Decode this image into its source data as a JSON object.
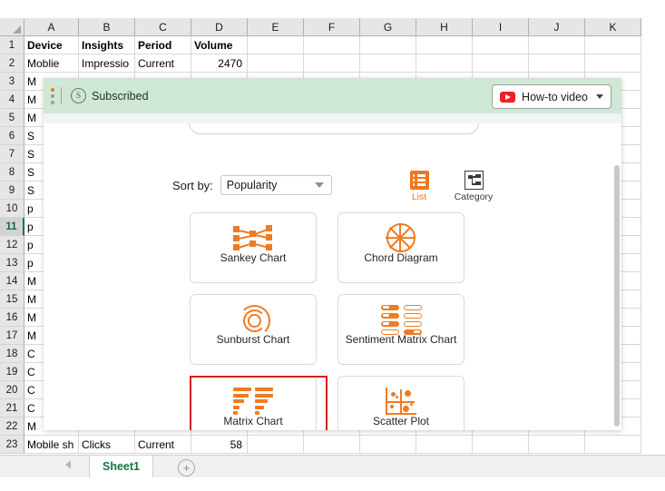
{
  "spreadsheet": {
    "columns": [
      "A",
      "B",
      "C",
      "D",
      "E",
      "F",
      "G",
      "H",
      "I",
      "J",
      "K"
    ],
    "rows": [
      {
        "n": "1",
        "cells": [
          "Device",
          "Insights",
          "Period",
          "Volume",
          "",
          "",
          "",
          "",
          "",
          "",
          ""
        ],
        "header": true
      },
      {
        "n": "2",
        "cells": [
          "Moblie",
          "Impressio",
          "Current",
          "2470",
          "",
          "",
          "",
          "",
          "",
          "",
          ""
        ]
      },
      {
        "n": "3",
        "cells": [
          "M",
          "",
          "",
          "",
          "",
          "",
          "",
          "",
          "",
          "",
          ""
        ]
      },
      {
        "n": "4",
        "cells": [
          "M",
          "",
          "",
          "",
          "",
          "",
          "",
          "",
          "",
          "",
          ""
        ]
      },
      {
        "n": "5",
        "cells": [
          "M",
          "",
          "",
          "",
          "",
          "",
          "",
          "",
          "",
          "",
          ""
        ]
      },
      {
        "n": "6",
        "cells": [
          "S",
          "",
          "",
          "",
          "",
          "",
          "",
          "",
          "",
          "",
          ""
        ]
      },
      {
        "n": "7",
        "cells": [
          "S",
          "",
          "",
          "",
          "",
          "",
          "",
          "",
          "",
          "",
          ""
        ]
      },
      {
        "n": "8",
        "cells": [
          "S",
          "",
          "",
          "",
          "",
          "",
          "",
          "",
          "",
          "",
          ""
        ]
      },
      {
        "n": "9",
        "cells": [
          "S",
          "",
          "",
          "",
          "",
          "",
          "",
          "",
          "",
          "",
          ""
        ]
      },
      {
        "n": "10",
        "cells": [
          "p",
          "",
          "",
          "",
          "",
          "",
          "",
          "",
          "",
          "",
          ""
        ]
      },
      {
        "n": "11",
        "cells": [
          "p",
          "",
          "",
          "",
          "",
          "",
          "",
          "",
          "",
          "",
          ""
        ],
        "selected": true
      },
      {
        "n": "12",
        "cells": [
          "p",
          "",
          "",
          "",
          "",
          "",
          "",
          "",
          "",
          "",
          ""
        ]
      },
      {
        "n": "13",
        "cells": [
          "p",
          "",
          "",
          "",
          "",
          "",
          "",
          "",
          "",
          "",
          ""
        ]
      },
      {
        "n": "14",
        "cells": [
          "M",
          "",
          "",
          "",
          "",
          "",
          "",
          "",
          "",
          "",
          ""
        ]
      },
      {
        "n": "15",
        "cells": [
          "M",
          "",
          "",
          "",
          "",
          "",
          "",
          "",
          "",
          "",
          ""
        ]
      },
      {
        "n": "16",
        "cells": [
          "M",
          "",
          "",
          "",
          "",
          "",
          "",
          "",
          "",
          "",
          ""
        ]
      },
      {
        "n": "17",
        "cells": [
          "M",
          "",
          "",
          "",
          "",
          "",
          "",
          "",
          "",
          "",
          ""
        ]
      },
      {
        "n": "18",
        "cells": [
          "C",
          "",
          "",
          "",
          "",
          "",
          "",
          "",
          "",
          "",
          ""
        ]
      },
      {
        "n": "19",
        "cells": [
          "C",
          "",
          "",
          "",
          "",
          "",
          "",
          "",
          "",
          "",
          ""
        ]
      },
      {
        "n": "20",
        "cells": [
          "C",
          "",
          "",
          "",
          "",
          "",
          "",
          "",
          "",
          "",
          ""
        ]
      },
      {
        "n": "21",
        "cells": [
          "C",
          "",
          "",
          "",
          "",
          "",
          "",
          "",
          "",
          "",
          ""
        ]
      },
      {
        "n": "22",
        "cells": [
          "M",
          "",
          "",
          "",
          "",
          "",
          "",
          "",
          "",
          "",
          ""
        ]
      },
      {
        "n": "23",
        "cells": [
          "Mobile sh",
          "Clicks",
          "Current",
          "58",
          "",
          "",
          "",
          "",
          "",
          "",
          ""
        ]
      }
    ],
    "tabbar": {
      "sheet_name": "Sheet1",
      "add_sheet_label": "+"
    }
  },
  "addin": {
    "header": {
      "subscription_status": "Subscribed",
      "coin_glyph": "S",
      "howto_label": "How-to video"
    },
    "toolbar": {
      "sort_label": "Sort by:",
      "sort_value": "Popularity",
      "view_modes": [
        {
          "label": "List",
          "active": true
        },
        {
          "label": "Category",
          "active": false
        }
      ]
    },
    "cards": [
      [
        {
          "label": "Sankey Chart",
          "icon": "sankey-icon",
          "selected": false
        },
        {
          "label": "Chord Diagram",
          "icon": "chord-icon",
          "selected": false
        }
      ],
      [
        {
          "label": "Sunburst Chart",
          "icon": "sunburst-icon",
          "selected": false
        },
        {
          "label": "Sentiment Matrix Chart",
          "icon": "sentiment-matrix-icon",
          "selected": false
        }
      ],
      [
        {
          "label": "Matrix Chart",
          "icon": "matrix-chart-icon",
          "selected": true
        },
        {
          "label": "Scatter Plot",
          "icon": "scatter-plot-icon",
          "selected": false
        }
      ]
    ]
  },
  "colors": {
    "accent_orange": "#f07b22",
    "header_green": "#cfe8d6",
    "highlight_red": "#d32020",
    "youtube_red": "#ec2222",
    "sheet_tab_green": "#1a7544"
  }
}
